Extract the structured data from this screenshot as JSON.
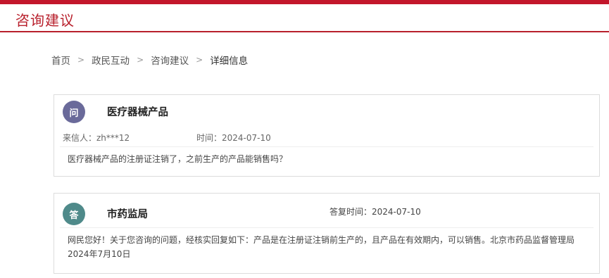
{
  "header": {
    "title": "咨询建议"
  },
  "breadcrumb": {
    "items": [
      "首页",
      "政民互动",
      "咨询建议"
    ],
    "current": "详细信息",
    "separator": ">"
  },
  "question": {
    "badge": "问",
    "title": "医疗器械产品",
    "sender": "来信人：zh***12",
    "time": "时间：2024-07-10",
    "content": "医疗器械产品的注册证注销了，之前生产的产品能销售吗？"
  },
  "answer": {
    "badge": "答",
    "title": "市药监局",
    "time": "答复时间：2024-07-10",
    "content": "网民您好！关于您咨询的问题，经核实回复如下：产品是在注册证注销前生产的，且产品在有效期内，可以销售。北京市药品监督管理局　2024年7月10日"
  },
  "colors": {
    "brand": "#b8202c",
    "question_badge": "#6a6a9a",
    "answer_badge": "#4f8a8a"
  }
}
